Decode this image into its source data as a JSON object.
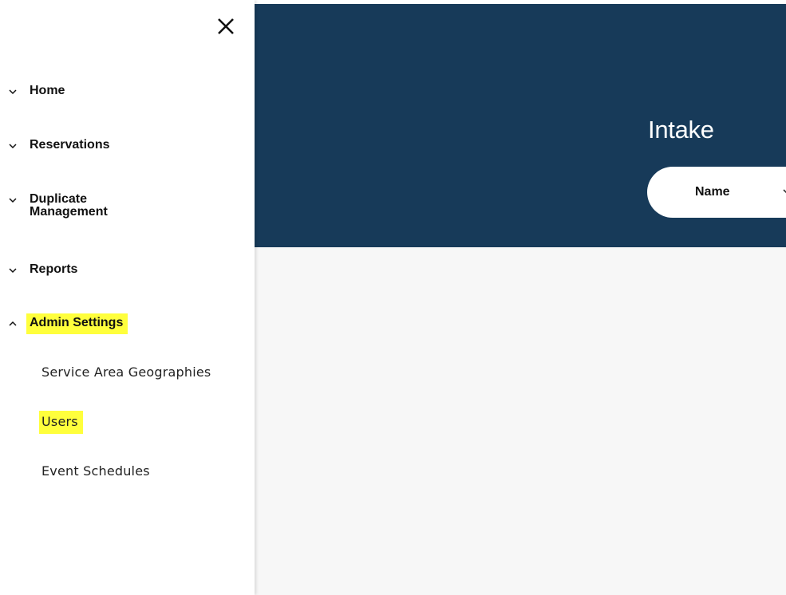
{
  "header": {
    "title": "Intake",
    "search_field_label": "Name"
  },
  "sidebar": {
    "close_icon": "close-icon",
    "items": [
      {
        "label": "Home",
        "icon": "chevron-down-icon",
        "expanded": false
      },
      {
        "label": "Reservations",
        "icon": "chevron-down-icon",
        "expanded": false
      },
      {
        "label_line1": "Duplicate",
        "label_line2": "Management",
        "icon": "chevron-down-icon",
        "expanded": false
      },
      {
        "label": "Reports",
        "icon": "chevron-down-icon",
        "expanded": false
      },
      {
        "label": "Admin Settings",
        "icon": "chevron-up-icon",
        "expanded": true,
        "highlighted": true
      }
    ],
    "admin_subitems": [
      {
        "label": "Service Area Geographies"
      },
      {
        "label": "Users",
        "highlighted": true
      },
      {
        "label": "Event Schedules"
      }
    ]
  },
  "colors": {
    "hero_background": "#173a59",
    "highlight": "#ffff3c",
    "main_background": "#f7f7f7"
  }
}
